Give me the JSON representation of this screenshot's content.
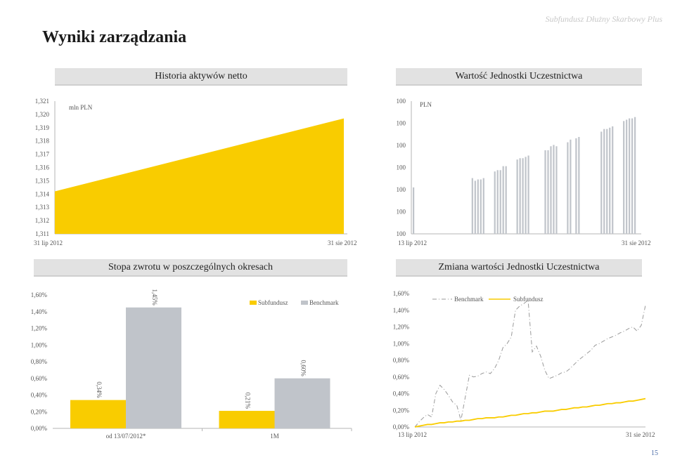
{
  "header": {
    "fund_name": "Subfundusz Dłużny Skarbowy Plus",
    "title": "Wyniki zarządzania",
    "page_number": "15"
  },
  "panels": {
    "nav_history": "Historia aktywów netto",
    "unit_value": "Wartość Jednostki Uczestnictwa",
    "returns": "Stopa zwrotu w poszczególnych okresach",
    "unit_change": "Zmiana wartości Jednostki Uczestnictwa"
  },
  "colors": {
    "subfund": "#f9cc00",
    "benchmark": "#c0c4ca",
    "header_bg": "#e2e2e2"
  },
  "chart_data": [
    {
      "id": "nav",
      "type": "area",
      "unit_label": "mln PLN",
      "ylim": [
        1.311,
        1.321
      ],
      "yticks": [
        "1,321",
        "1,320",
        "1,319",
        "1,318",
        "1,317",
        "1,316",
        "1,315",
        "1,314",
        "1,313",
        "1,312",
        "1,311"
      ],
      "xlabels": [
        "31 lip 2012",
        "31 sie 2012"
      ],
      "x": [
        0,
        1
      ],
      "values": [
        1.3142,
        1.3197
      ],
      "color": "#f9cc00"
    },
    {
      "id": "unit",
      "type": "bar",
      "unit_label": "PLN",
      "yticks": [
        "100",
        "100",
        "100",
        "100",
        "100",
        "100",
        "100"
      ],
      "xlabels": [
        "13 lip 2012",
        "31 sie 2012"
      ],
      "values": [
        0.35,
        0,
        0,
        0,
        0,
        0,
        0,
        0,
        0,
        0,
        0,
        0,
        0,
        0,
        0,
        0,
        0,
        0,
        0,
        0,
        0,
        0.42,
        0.4,
        0.41,
        0.41,
        0.42,
        0,
        0,
        0,
        0.47,
        0.48,
        0.48,
        0.51,
        0.51,
        0,
        0,
        0,
        0.56,
        0.57,
        0.57,
        0.58,
        0.59,
        0,
        0,
        0,
        0,
        0,
        0.63,
        0.63,
        0.66,
        0.67,
        0.66,
        0,
        0,
        0,
        0.69,
        0.71,
        0,
        0.72,
        0.73,
        0,
        0,
        0,
        0,
        0,
        0,
        0,
        0.77,
        0.79,
        0.79,
        0.8,
        0.81,
        0,
        0,
        0,
        0.85,
        0.86,
        0.87,
        0.87,
        0.88
      ],
      "color": "#c0c4ca"
    },
    {
      "id": "returns",
      "type": "bar",
      "yticks": [
        "1,60%",
        "1,40%",
        "1,20%",
        "1,00%",
        "0,80%",
        "0,60%",
        "0,40%",
        "0,20%",
        "0,00%"
      ],
      "ylim": [
        0,
        1.6
      ],
      "categories": [
        "od 13/07/2012*",
        "1M"
      ],
      "series": [
        {
          "name": "Subfundusz",
          "values": [
            0.34,
            0.21
          ],
          "labels": [
            "0,34%",
            "0,21%"
          ]
        },
        {
          "name": "Benchmark",
          "values": [
            1.45,
            0.6
          ],
          "labels": [
            "1,45%",
            "0,60%"
          ]
        }
      ]
    },
    {
      "id": "change",
      "type": "line",
      "yticks": [
        "1,60%",
        "1,40%",
        "1,20%",
        "1,00%",
        "0,80%",
        "0,60%",
        "0,40%",
        "0,20%",
        "0,00%"
      ],
      "ylim": [
        0,
        1.6
      ],
      "xlabels": [
        "13 lip 2012",
        "31 sie 2012"
      ],
      "series": [
        {
          "name": "Benchmark",
          "values": [
            0,
            0.06,
            0.11,
            0.15,
            0.12,
            0.4,
            0.5,
            0.45,
            0.38,
            0.3,
            0.26,
            0.08,
            0.35,
            0.62,
            0.6,
            0.61,
            0.64,
            0.66,
            0.64,
            0.7,
            0.8,
            0.95,
            1.0,
            1.08,
            1.4,
            1.45,
            1.48,
            1.52,
            0.9,
            0.97,
            0.85,
            0.68,
            0.58,
            0.6,
            0.62,
            0.65,
            0.66,
            0.7,
            0.75,
            0.8,
            0.84,
            0.88,
            0.92,
            0.98,
            1.0,
            1.03,
            1.06,
            1.08,
            1.1,
            1.13,
            1.15,
            1.18,
            1.2,
            1.15,
            1.22,
            1.46
          ]
        },
        {
          "name": "Subfundusz",
          "values": [
            0,
            0.01,
            0.02,
            0.03,
            0.03,
            0.04,
            0.05,
            0.05,
            0.06,
            0.06,
            0.07,
            0.07,
            0.08,
            0.08,
            0.09,
            0.1,
            0.1,
            0.11,
            0.11,
            0.11,
            0.12,
            0.12,
            0.13,
            0.14,
            0.14,
            0.15,
            0.16,
            0.16,
            0.17,
            0.17,
            0.18,
            0.19,
            0.19,
            0.19,
            0.2,
            0.21,
            0.21,
            0.22,
            0.23,
            0.23,
            0.24,
            0.24,
            0.25,
            0.26,
            0.26,
            0.27,
            0.28,
            0.28,
            0.29,
            0.29,
            0.3,
            0.31,
            0.31,
            0.32,
            0.33,
            0.34
          ]
        }
      ]
    }
  ]
}
